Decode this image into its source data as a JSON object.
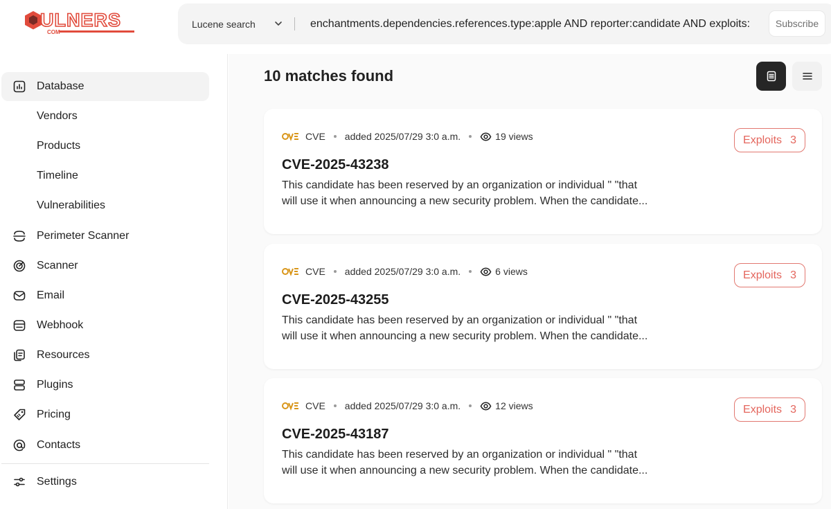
{
  "brand": {
    "logo_text": "ULNERS",
    "logo_sub": "COM",
    "colors": {
      "primary": "#e14b3c",
      "accent": "#e4655c",
      "dark": "#262626"
    }
  },
  "header": {
    "search_mode": "Lucene search",
    "search_query": "enchantments.dependencies.references.type:apple AND reporter:candidate AND exploits:",
    "subscribe_label": "Subscribe"
  },
  "sidebar": {
    "items": [
      {
        "label": "Database",
        "icon": "chart-icon",
        "active": true
      },
      {
        "label": "Vendors"
      },
      {
        "label": "Products"
      },
      {
        "label": "Timeline"
      },
      {
        "label": "Vulnerabilities"
      },
      {
        "label": "Perimeter Scanner",
        "icon": "perimeter-icon"
      },
      {
        "label": "Scanner",
        "icon": "target-icon"
      },
      {
        "label": "Email",
        "icon": "mail-icon"
      },
      {
        "label": "Webhook",
        "icon": "webhook-icon"
      },
      {
        "label": "Resources",
        "icon": "files-icon"
      },
      {
        "label": "Plugins",
        "icon": "stack-icon"
      },
      {
        "label": "Pricing",
        "icon": "tag-icon"
      },
      {
        "label": "Contacts",
        "icon": "at-icon"
      },
      {
        "label": "Settings",
        "icon": "sliders-icon"
      }
    ]
  },
  "main": {
    "results_title": "10 matches found",
    "view_modes": [
      "card-view-icon",
      "list-view-icon"
    ],
    "results": [
      {
        "source": "CVE",
        "added": "added 2025/07/29 3:0 a.m.",
        "views": "19 views",
        "title": "CVE-2025-43238",
        "desc_line1": "This candidate has been reserved by an organization or individual \" \"that",
        "desc_line2": "will use it when announcing a new security problem. When the candidate...",
        "exploits_label": "Exploits",
        "exploits_count": "3"
      },
      {
        "source": "CVE",
        "added": "added 2025/07/29 3:0 a.m.",
        "views": "6 views",
        "title": "CVE-2025-43255",
        "desc_line1": "This candidate has been reserved by an organization or individual \" \"that",
        "desc_line2": "will use it when announcing a new security problem. When the candidate...",
        "exploits_label": "Exploits",
        "exploits_count": "3"
      },
      {
        "source": "CVE",
        "added": "added 2025/07/29 3:0 a.m.",
        "views": "12 views",
        "title": "CVE-2025-43187",
        "desc_line1": "This candidate has been reserved by an organization or individual \" \"that",
        "desc_line2": "will use it when announcing a new security problem. When the candidate...",
        "exploits_label": "Exploits",
        "exploits_count": "3"
      }
    ]
  }
}
